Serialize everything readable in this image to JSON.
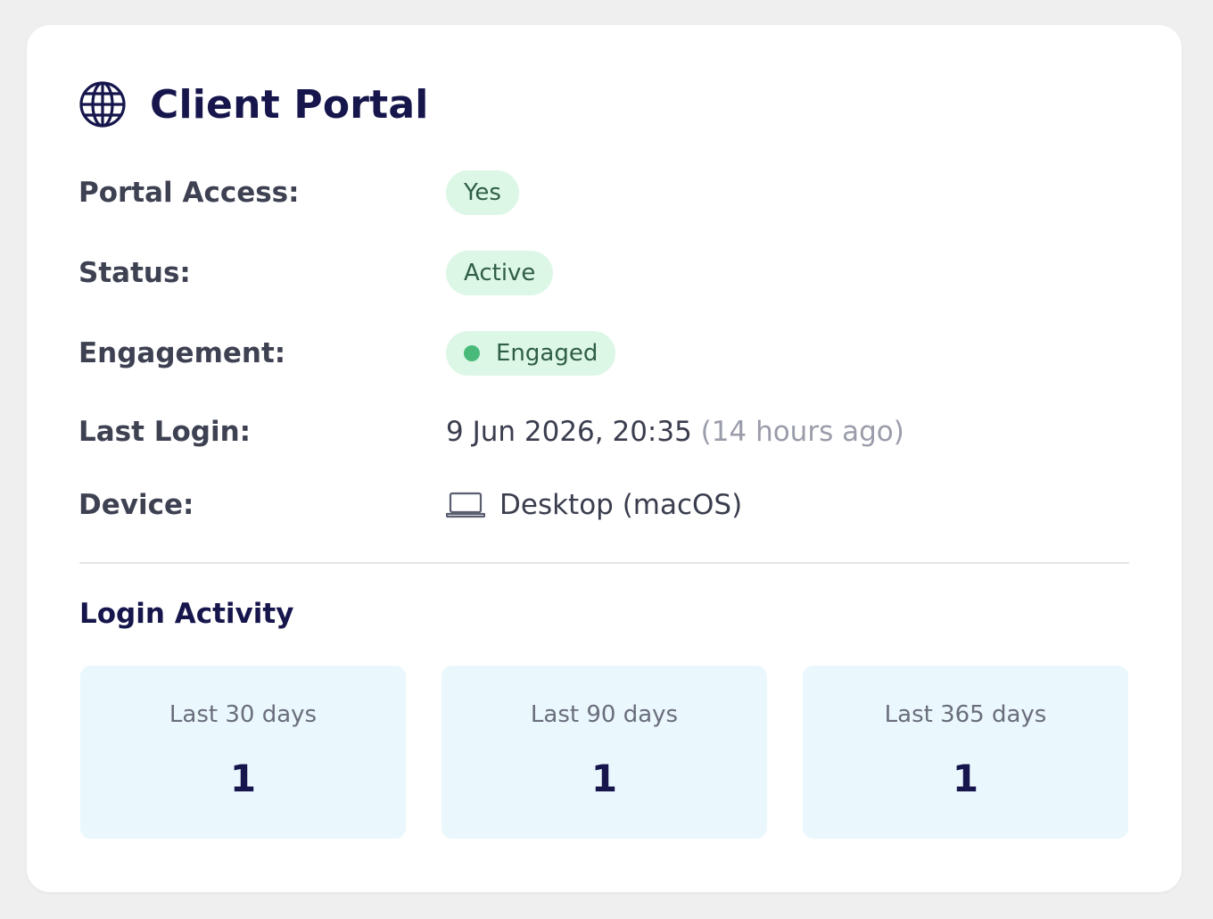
{
  "card": {
    "title": "Client Portal",
    "icon": "globe-icon"
  },
  "fields": {
    "portal_access": {
      "label": "Portal Access:",
      "value": "Yes"
    },
    "status": {
      "label": "Status:",
      "value": "Active"
    },
    "engagement": {
      "label": "Engagement:",
      "value": "Engaged"
    },
    "last_login": {
      "label": "Last Login:",
      "value": "9 Jun 2026, 20:35",
      "relative": "(14 hours ago)"
    },
    "device": {
      "label": "Device:",
      "value": "Desktop (macOS)",
      "icon": "laptop-icon"
    }
  },
  "login_activity": {
    "title": "Login Activity",
    "stats": [
      {
        "label": "Last 30 days",
        "value": "1"
      },
      {
        "label": "Last 90 days",
        "value": "1"
      },
      {
        "label": "Last 365 days",
        "value": "1"
      }
    ]
  },
  "colors": {
    "title": "#16164d",
    "badge_bg": "#dcf7e6",
    "badge_text": "#2f5e44",
    "engaged_dot": "#4aba7a",
    "stat_bg": "#eaf7fc"
  }
}
